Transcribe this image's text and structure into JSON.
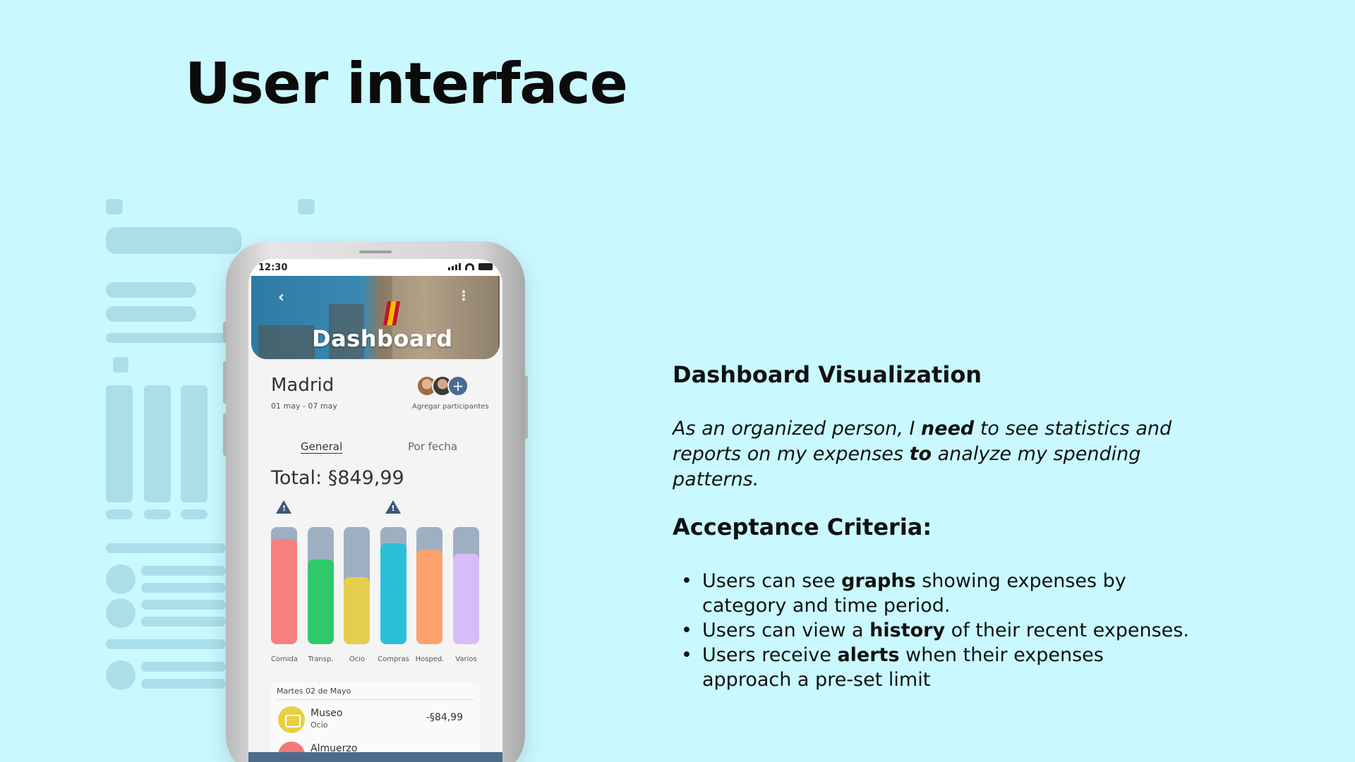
{
  "slide": {
    "title": "User interface"
  },
  "phone": {
    "status_time": "12:30",
    "header_title": "Dashboard",
    "back_icon": "chevron-left-icon",
    "more_icon": "more-vertical-icon",
    "trip_name": "Madrid",
    "trip_dates": "01 may - 07 may",
    "participants_label": "Agregar participantes",
    "add_participant_symbol": "+",
    "tabs": {
      "general": "General",
      "by_date": "Por fecha"
    },
    "total": "Total: §849,99",
    "warning_symbol": "!",
    "chart_data": {
      "type": "bar",
      "categories": [
        "Comida",
        "Transp.",
        "Ocio",
        "Compras",
        "Hosped.",
        "Varios"
      ],
      "values": [
        0.9,
        0.72,
        0.57,
        0.86,
        0.81,
        0.77
      ],
      "colors": [
        "#f87f7f",
        "#2fc96c",
        "#e3cf4b",
        "#2cc0d8",
        "#fca26c",
        "#d8bcf7"
      ],
      "track_color": "#9fafc2",
      "alerts": [
        "Comida",
        "Compras"
      ]
    },
    "list": {
      "date_header": "Martes 02 de Mayo",
      "items": [
        {
          "name": "Museo",
          "category": "Ocio",
          "amount": "-§84,99"
        },
        {
          "name": "Almuerzo",
          "category": "",
          "amount": ""
        }
      ]
    }
  },
  "right": {
    "story_heading": "Dashboard Visualization",
    "story_parts": [
      "As an organized person, I ",
      "need",
      " to see statistics and reports on my expenses ",
      "to",
      " analyze my spending patterns."
    ],
    "criteria_heading": "Acceptance Criteria:",
    "criteria": [
      [
        "Users can see ",
        "graphs",
        " showing expenses by category and time period."
      ],
      [
        "Users can view a ",
        "history",
        " of their recent expenses."
      ],
      [
        "Users receive ",
        "alerts",
        " when their expenses approach a pre-set limit"
      ]
    ]
  }
}
